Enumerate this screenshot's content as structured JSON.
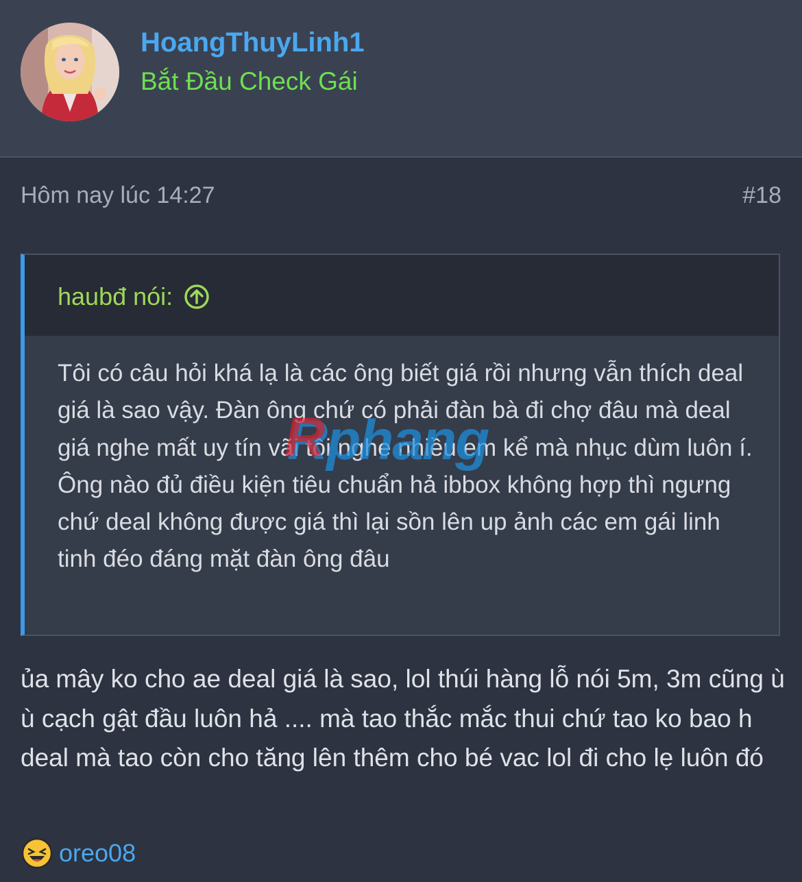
{
  "post": {
    "author": {
      "username": "HoangThuyLinh1",
      "title": "Bắt Đầu Check Gái",
      "avatar_icon": "user-avatar"
    },
    "timestamp": "Hôm nay lúc 14:27",
    "post_number": "#18",
    "quote": {
      "author_label": "haubđ nói:",
      "arrow_icon": "arrow-up-circle-icon",
      "text": "Tôi có câu hỏi khá lạ là các ông biết giá rồi nhưng vẫn thích deal giá là sao vậy. Đàn ông chứ có phải đàn bà đi chợ đâu mà deal giá nghe mất uy tín vãi tôi nghe nhiều em kể mà nhục dùm luôn í. Ông nào đủ điều kiện tiêu chuẩn hả ibbox không hợp thì ngưng chứ deal không được giá thì lại sồn lên up ảnh các em gái linh tinh đéo đáng mặt đàn ông đâu"
    },
    "body": "ủa mây ko cho ae deal giá là sao, lol thúi hàng lỗ nói 5m, 3m cũng ù ù cạch gật đầu luôn hả .... mà tao thắc mắc thui chứ tao ko bao h deal mà tao còn cho tăng lên thêm cho bé vac lol đi cho lẹ luôn đó",
    "reaction": {
      "icon": "laughing-emoji-icon",
      "user": "oreo08"
    },
    "watermark": "Rphang"
  },
  "colors": {
    "background": "#2d3340",
    "header_bg": "#3a4252",
    "username": "#4aa8f0",
    "user_title": "#6ee04e",
    "quote_author": "#9ed85a",
    "quote_border": "#3d9ae8",
    "text": "#dfe2e8",
    "muted": "#a8aeb9"
  }
}
